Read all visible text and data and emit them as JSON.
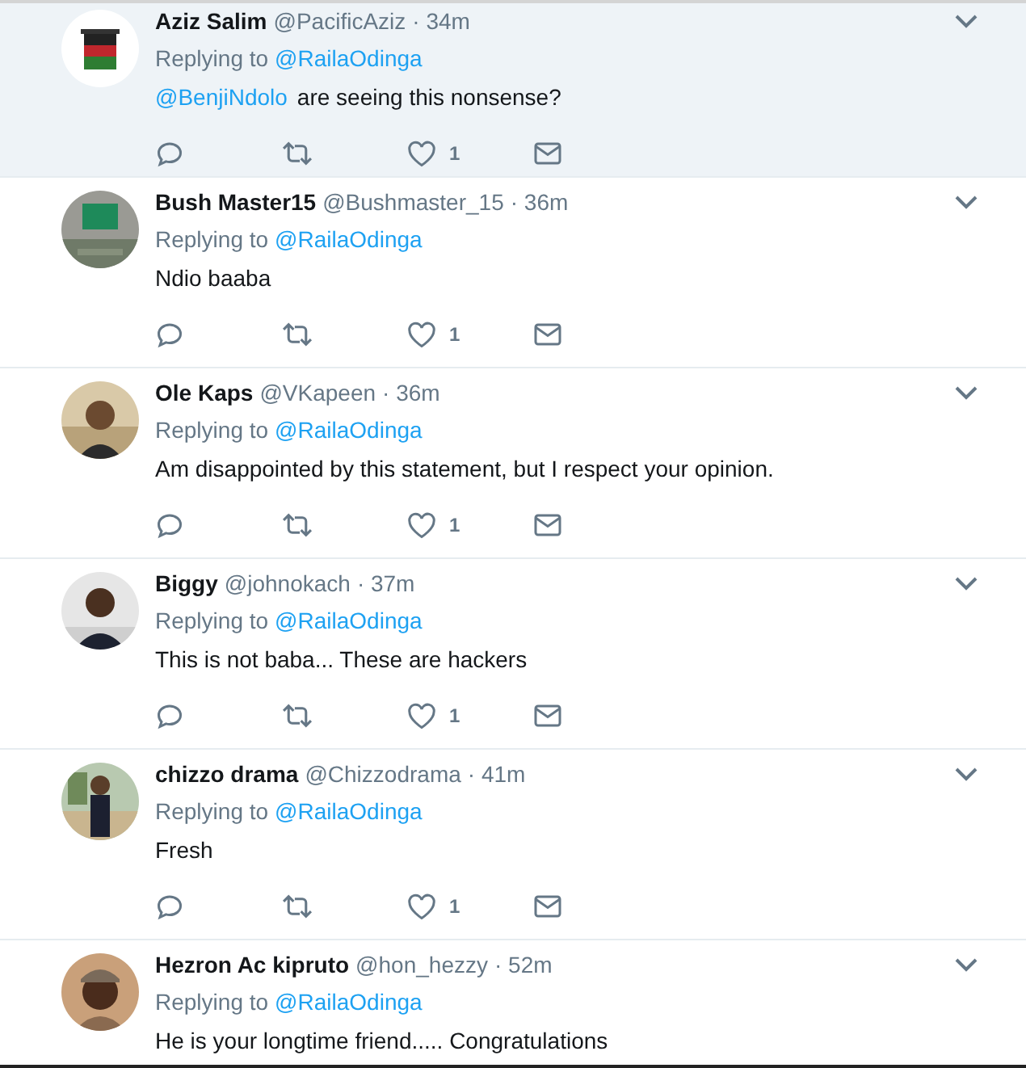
{
  "tweets": [
    {
      "name": "Aziz Salim",
      "handle": "@PacificAziz",
      "time": "· 34m",
      "replying_label": "Replying to",
      "replying_to": "@RailaOdinga",
      "mention": "@BenjiNdolo",
      "text": "are seeing this nonsense?",
      "highlighted": true,
      "likes": "1"
    },
    {
      "name": "Bush Master15",
      "handle": "@Bushmaster_15",
      "time": "· 36m",
      "replying_label": "Replying to",
      "replying_to": "@RailaOdinga",
      "text": "Ndio baaba",
      "highlighted": false,
      "likes": "1"
    },
    {
      "name": "Ole Kaps",
      "handle": "@VKapeen",
      "time": "· 36m",
      "replying_label": "Replying to",
      "replying_to": "@RailaOdinga",
      "text": "Am disappointed by this statement, but I respect your opinion.",
      "highlighted": false,
      "likes": "1"
    },
    {
      "name": "Biggy",
      "handle": "@johnokach",
      "time": "· 37m",
      "replying_label": "Replying to",
      "replying_to": "@RailaOdinga",
      "text": "This is not baba... These are hackers",
      "highlighted": false,
      "likes": "1"
    },
    {
      "name": "chizzo drama",
      "handle": "@Chizzodrama",
      "time": "· 41m",
      "replying_label": "Replying to",
      "replying_to": "@RailaOdinga",
      "text": "Fresh",
      "highlighted": false,
      "likes": "1"
    },
    {
      "name": "Hezron Ac kipruto",
      "handle": "@hon_hezzy",
      "time": "· 52m",
      "replying_label": "Replying to",
      "replying_to": "@RailaOdinga",
      "text": "He is your longtime friend..... Congratulations",
      "highlighted": false
    }
  ]
}
